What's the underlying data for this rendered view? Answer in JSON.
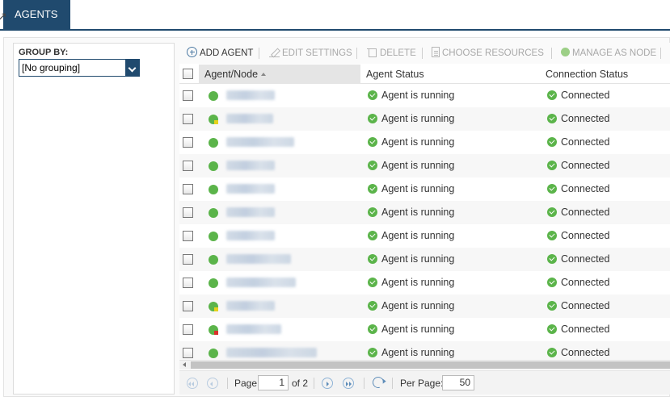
{
  "tabs": [
    {
      "label": "AGENTS",
      "active": true
    }
  ],
  "sidebar": {
    "group_by_label": "GROUP BY:",
    "group_by_value": "[No grouping]"
  },
  "toolbar": {
    "add_agent": "ADD AGENT",
    "edit_settings": "EDIT SETTINGS",
    "delete": "DELETE",
    "choose_resources": "CHOOSE RESOURCES",
    "manage_as_node": "MANAGE AS NODE"
  },
  "columns": {
    "agent_node": "Agent/Node",
    "agent_status": "Agent Status",
    "connection_status": "Connection Status"
  },
  "rows": [
    {
      "status": "Agent is running",
      "connection": "Connected",
      "badge": ""
    },
    {
      "status": "Agent is running",
      "connection": "Connected",
      "badge": "warning"
    },
    {
      "status": "Agent is running",
      "connection": "Connected",
      "badge": ""
    },
    {
      "status": "Agent is running",
      "connection": "Connected",
      "badge": ""
    },
    {
      "status": "Agent is running",
      "connection": "Connected",
      "badge": ""
    },
    {
      "status": "Agent is running",
      "connection": "Connected",
      "badge": ""
    },
    {
      "status": "Agent is running",
      "connection": "Connected",
      "badge": ""
    },
    {
      "status": "Agent is running",
      "connection": "Connected",
      "badge": ""
    },
    {
      "status": "Agent is running",
      "connection": "Connected",
      "badge": ""
    },
    {
      "status": "Agent is running",
      "connection": "Connected",
      "badge": "warning"
    },
    {
      "status": "Agent is running",
      "connection": "Connected",
      "badge": "critical"
    },
    {
      "status": "Agent is running",
      "connection": "Connected",
      "badge": ""
    }
  ],
  "pager": {
    "page_label": "Page",
    "page_value": "1",
    "of_label": "of 2",
    "per_page_label": "Per Page:",
    "per_page_value": "50"
  },
  "colors": {
    "brand": "#204a6e",
    "ok": "#5bb44a",
    "warning": "#e6d21c",
    "critical": "#d9302c"
  }
}
